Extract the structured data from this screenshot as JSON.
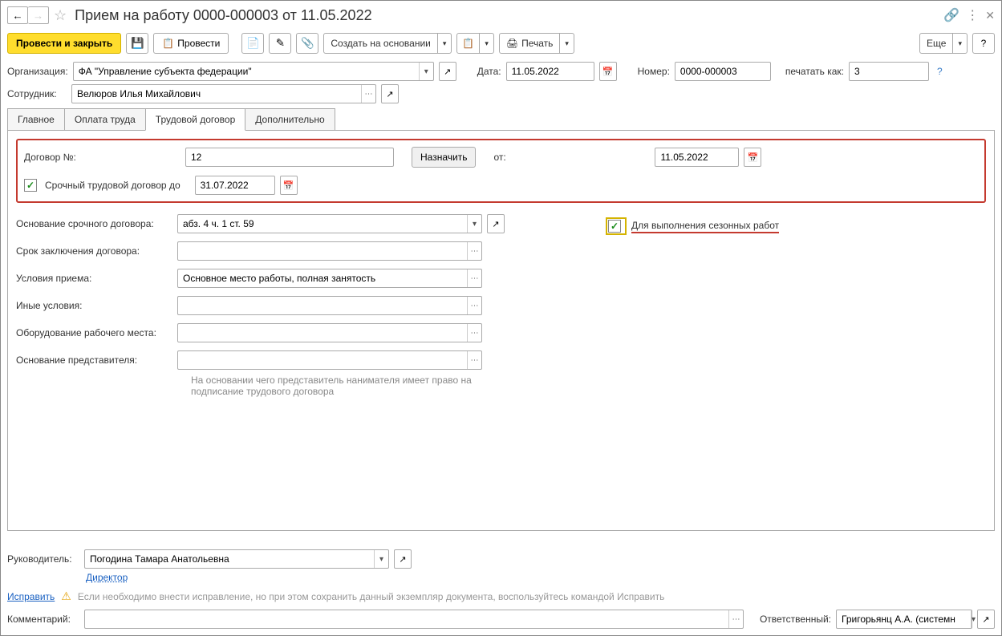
{
  "title": "Прием на работу 0000-000003 от 11.05.2022",
  "toolbar": {
    "post_close": "Провести и закрыть",
    "post": "Провести",
    "create_based": "Создать на основании",
    "print": "Печать",
    "more": "Еще",
    "help": "?"
  },
  "header": {
    "org_label": "Организация:",
    "org_value": "ФА \"Управление субъекта федерации\"",
    "date_label": "Дата:",
    "date_value": "11.05.2022",
    "number_label": "Номер:",
    "number_value": "0000-000003",
    "print_as_label": "печатать как:",
    "print_as_value": "3",
    "employee_label": "Сотрудник:",
    "employee_value": "Велюров Илья Михайлович"
  },
  "tabs": {
    "main": "Главное",
    "salary": "Оплата труда",
    "contract": "Трудовой договор",
    "extra": "Дополнительно"
  },
  "contract": {
    "num_label": "Договор №:",
    "num_value": "12",
    "assign": "Назначить",
    "from_label": "от:",
    "from_value": "11.05.2022",
    "fixed_label": "Срочный трудовой договор до",
    "fixed_value": "31.07.2022",
    "basis_label": "Основание срочного договора:",
    "basis_value": "абз. 4 ч. 1 ст. 59",
    "seasonal": "Для выполнения сезонных работ",
    "term_label": "Срок заключения договора:",
    "conditions_label": "Условия приема:",
    "conditions_value": "Основное место работы, полная занятость",
    "other_label": "Иные условия:",
    "equipment_label": "Оборудование рабочего места:",
    "rep_basis_label": "Основание представителя:",
    "rep_basis_help": "На основании чего представитель нанимателя имеет право на подписание трудового договора"
  },
  "footer": {
    "manager_label": "Руководитель:",
    "manager_value": "Погодина Тамара Анатольевна",
    "manager_link": "Директор",
    "fix_link": "Исправить",
    "fix_text": "Если необходимо внести исправление, но при этом сохранить данный экземпляр документа, воспользуйтесь командой Исправить",
    "comment_label": "Комментарий:",
    "responsible_label": "Ответственный:",
    "responsible_value": "Григорьянц А.А. (системн"
  }
}
